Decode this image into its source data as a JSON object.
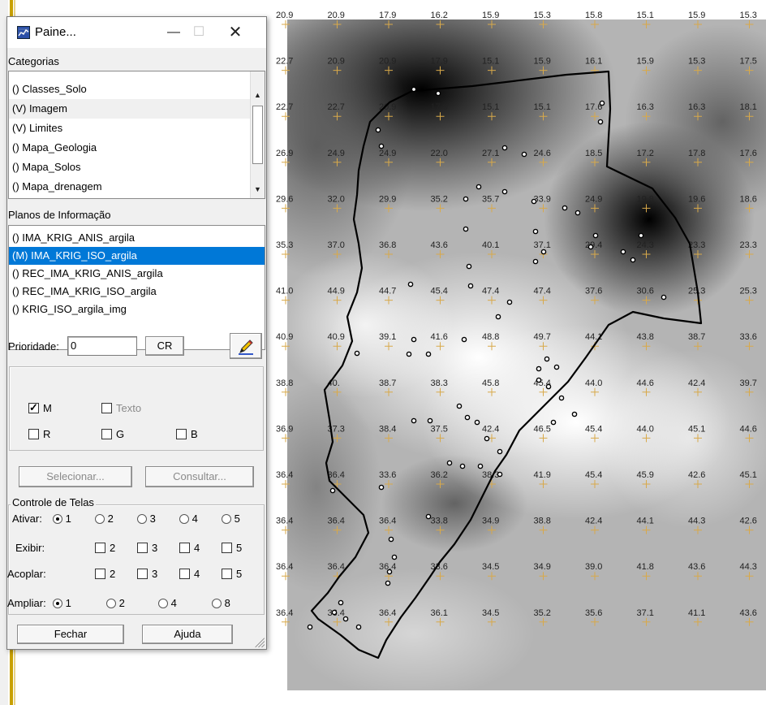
{
  "panel": {
    "title": "Paine...",
    "categorias_label": "Categorias",
    "categorias": [
      {
        "label": "() Classes_Solo"
      },
      {
        "label": "(V) Imagem",
        "highlighted": true
      },
      {
        "label": "(V) Limites"
      },
      {
        "label": "() Mapa_Geologia"
      },
      {
        "label": "() Mapa_Solos"
      },
      {
        "label": "() Mapa_drenagem"
      }
    ],
    "planos_label": "Planos de Informação",
    "planos": [
      {
        "label": "() IMA_KRIG_ANIS_argila"
      },
      {
        "label": "(M) IMA_KRIG_ISO_argila",
        "selected": true
      },
      {
        "label": "() REC_IMA_KRIG_ANIS_argila"
      },
      {
        "label": "() REC_IMA_KRIG_ISO_argila"
      },
      {
        "label": "() KRIG_ISO_argila_img"
      }
    ],
    "prioridade_label": "Prioridade:",
    "prioridade_value": "0",
    "cr_label": "CR",
    "check_m": "M",
    "check_texto": "Texto",
    "check_r": "R",
    "check_g": "G",
    "check_b": "B",
    "selecionar_label": "Selecionar...",
    "consultar_label": "Consultar...",
    "controle_label": "Controle de Telas",
    "ativar_label": "Ativar:",
    "ativar_options": [
      "1",
      "2",
      "3",
      "4",
      "5"
    ],
    "exibir_label": "Exibir:",
    "exibir_options": [
      "2",
      "3",
      "4",
      "5"
    ],
    "acoplar_label": "Acoplar:",
    "acoplar_options": [
      "2",
      "3",
      "4",
      "5"
    ],
    "ampliar_label": "Ampliar:",
    "ampliar_options": [
      "1",
      "2",
      "4",
      "8"
    ],
    "fechar_label": "Fechar",
    "ajuda_label": "Ajuda"
  },
  "grid": {
    "values": [
      [
        "20.9",
        "20.9",
        "17.9",
        "16.2",
        "15.9",
        "15.3",
        "15.8",
        "15.1",
        "15.9",
        "15.3"
      ],
      [
        "22.7",
        "20.9",
        "20.9",
        "17.9",
        "15.1",
        "15.9",
        "16.1",
        "15.9",
        "15.3",
        "17.5"
      ],
      [
        "22.7",
        "22.7",
        "20.9",
        "17.9",
        "15.1",
        "15.1",
        "17.6",
        "16.3",
        "16.3",
        "18.1"
      ],
      [
        "26.9",
        "24.9",
        "24.9",
        "22.0",
        "27.1",
        "24.6",
        "18.5",
        "17.2",
        "17.8",
        "17.6"
      ],
      [
        "29.6",
        "32.0",
        "29.9",
        "35.2",
        "35.7",
        "33.9",
        "24.9",
        "19.8",
        "19.6",
        "18.6"
      ],
      [
        "35.3",
        "37.0",
        "36.8",
        "43.6",
        "40.1",
        "37.1",
        "29.4",
        "24.3",
        "23.3",
        "23.3"
      ],
      [
        "41.0",
        "44.9",
        "44.7",
        "45.4",
        "47.4",
        "47.4",
        "37.6",
        "30.6",
        "25.3",
        "25.3"
      ],
      [
        "40.9",
        "40.9",
        "39.1",
        "41.6",
        "48.8",
        "49.7",
        "44.1",
        "43.8",
        "38.7",
        "33.6"
      ],
      [
        "38.8",
        "40.",
        "38.7",
        "38.3",
        "45.8",
        "45.4",
        "44.0",
        "44.6",
        "42.4",
        "39.7"
      ],
      [
        "36.9",
        "37.3",
        "38.4",
        "37.5",
        "42.4",
        "46.5",
        "45.4",
        "44.0",
        "45.1",
        "44.6"
      ],
      [
        "36.4",
        "36.4",
        "33.6",
        "36.2",
        "38.3",
        "41.9",
        "45.4",
        "45.9",
        "42.6",
        "45.1"
      ],
      [
        "36.4",
        "36.4",
        "36.4",
        "33.8",
        "34.9",
        "38.8",
        "42.4",
        "44.1",
        "44.3",
        "42.6"
      ],
      [
        "36.4",
        "36.4",
        "36.4",
        "33.6",
        "34.5",
        "34.9",
        "39.0",
        "41.8",
        "43.6",
        "44.3"
      ],
      [
        "36.4",
        "36.4",
        "36.4",
        "36.1",
        "34.5",
        "35.2",
        "35.6",
        "37.1",
        "41.1",
        "43.6"
      ]
    ]
  }
}
